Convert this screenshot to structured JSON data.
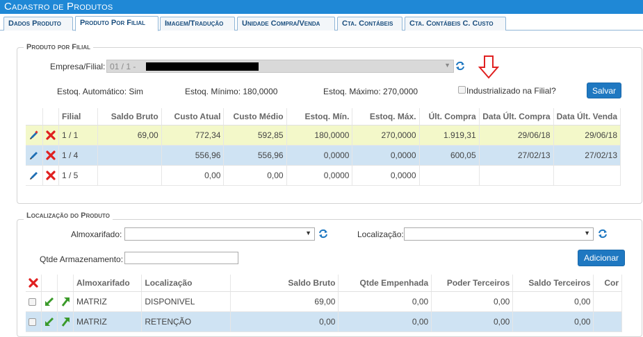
{
  "window_title": "Cadastro de Produtos",
  "tabs": [
    {
      "label": "Dados Produto",
      "active": false
    },
    {
      "label": "Produto Por Filial",
      "active": true
    },
    {
      "label": "Imagem/Tradução",
      "active": false
    },
    {
      "label": "Unidade Compra/Venda",
      "active": false
    },
    {
      "label": "Cta. Contábeis",
      "active": false
    },
    {
      "label": "Cta. Contábeis C. Custo",
      "active": false
    }
  ],
  "filial_section": {
    "legend": "Produto por Filial",
    "empresa_label": "Empresa/Filial:",
    "empresa_value": "01 / 1 -",
    "estoq_auto": "Estoq. Automático: Sim",
    "estoq_min": "Estoq. Mínimo: 180,0000",
    "estoq_max": "Estoq. Máximo: 270,0000",
    "industrializado_label": "Industrializado na Filial?",
    "save_label": "Salvar",
    "columns": [
      "Filial",
      "Saldo Bruto",
      "Custo Atual",
      "Custo Médio",
      "Estoq. Mín.",
      "Estoq. Máx.",
      "Últ. Compra",
      "Data Últ. Compra",
      "Data Últ. Venda"
    ],
    "rows": [
      {
        "filial": "1 / 1",
        "saldo": "69,00",
        "custo_atual": "772,34",
        "custo_medio": "592,85",
        "min": "180,0000",
        "max": "270,0000",
        "ult_compra": "1.919,31",
        "data_compra": "29/06/18",
        "data_venda": "29/06/18"
      },
      {
        "filial": "1 / 4",
        "saldo": "",
        "custo_atual": "556,96",
        "custo_medio": "556,96",
        "min": "0,0000",
        "max": "0,0000",
        "ult_compra": "600,05",
        "data_compra": "27/02/13",
        "data_venda": "27/02/13"
      },
      {
        "filial": "1 / 5",
        "saldo": "",
        "custo_atual": "0,00",
        "custo_medio": "0,00",
        "min": "0,0000",
        "max": "0,0000",
        "ult_compra": "",
        "data_compra": "",
        "data_venda": ""
      }
    ]
  },
  "local_section": {
    "legend": "Localização do Produto",
    "almox_label": "Almoxarifado:",
    "local_label": "Localização:",
    "qtde_label": "Qtde Armazenamento:",
    "add_label": "Adicionar",
    "columns": [
      "Almoxarifado",
      "Localização",
      "Saldo Bruto",
      "Qtde Empenhada",
      "Poder Terceiros",
      "Saldo Terceiros",
      "Cor"
    ],
    "rows": [
      {
        "almox": "MATRIZ",
        "local": "DISPONIVEL",
        "saldo": "69,00",
        "empenhada": "0,00",
        "poder": "0,00",
        "saldo_terc": "0,00"
      },
      {
        "almox": "MATRIZ",
        "local": "RETENÇÃO",
        "saldo": "0,00",
        "empenhada": "0,00",
        "poder": "0,00",
        "saldo_terc": "0,00"
      }
    ]
  },
  "colors": {
    "accent": "#1f88d6",
    "button": "#1f78c1",
    "row_highlight": "#f3f8c9",
    "row_selected": "#cfe3f3",
    "arrow": "#e02020"
  }
}
